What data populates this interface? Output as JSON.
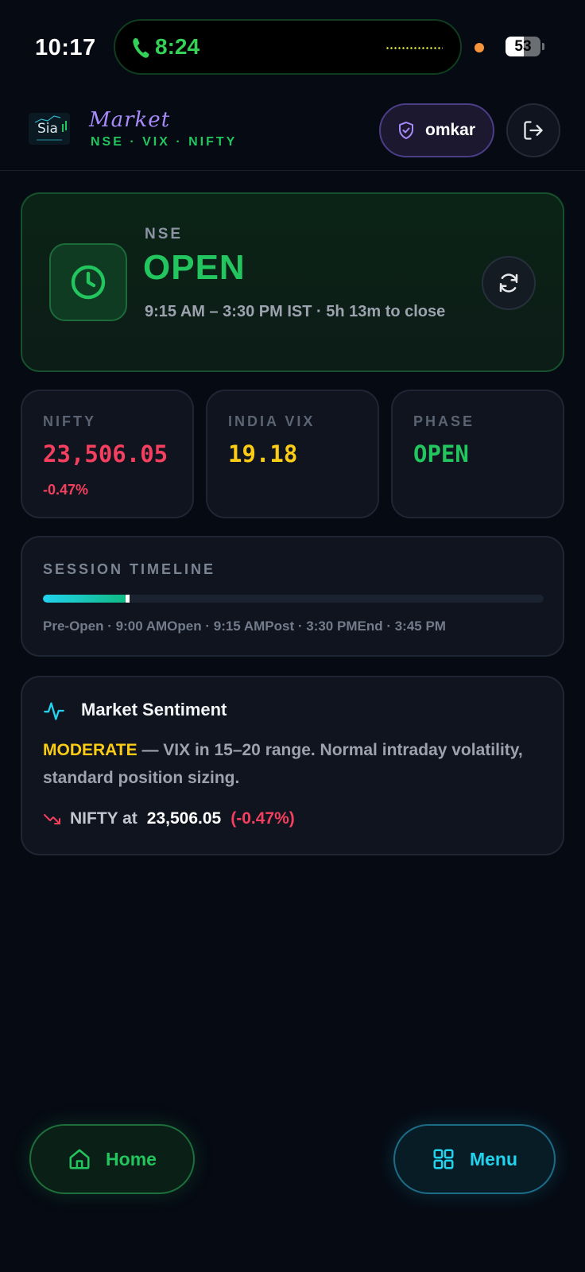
{
  "status_bar": {
    "time": "10:17",
    "call_time": "8:24",
    "battery": "53",
    "battery_level": 0.53
  },
  "header": {
    "logo_text": "Sia",
    "brand_title": "Market",
    "brand_subtitle": "NSE · VIX · NIFTY",
    "user_name": "omkar"
  },
  "market_status": {
    "exchange": "NSE",
    "status": "OPEN",
    "hours": "9:15 AM – 3:30 PM IST · 5h 13m to close"
  },
  "stats": {
    "nifty": {
      "label": "NIFTY",
      "value": "23,506.05",
      "change": "-0.47%"
    },
    "vix": {
      "label": "INDIA VIX",
      "value": "19.18"
    },
    "phase": {
      "label": "PHASE",
      "value": "OPEN"
    }
  },
  "timeline": {
    "title": "SESSION TIMELINE",
    "progress": 0.17,
    "labels": "Pre-Open · 9:00 AMOpen · 9:15 AMPost · 3:30 PMEnd · 3:45 PM"
  },
  "sentiment": {
    "title": "Market Sentiment",
    "level": "MODERATE",
    "description": " — VIX in 15–20 range. Normal intraday volatility, standard position sizing.",
    "nifty_label": "NIFTY at",
    "nifty_value": "23,506.05",
    "nifty_change": "(-0.47%)"
  },
  "nav": {
    "home_label": "Home",
    "menu_label": "Menu"
  },
  "colors": {
    "background": "#060a13",
    "positive": "#22c55e",
    "negative": "#f43f5e",
    "vix": "#facc15",
    "accent_cyan": "#22d3ee",
    "accent_purple": "#a78bfa"
  },
  "icons": {
    "call": "phone-icon",
    "user_badge": "shield-check-icon",
    "logout": "logout-icon",
    "market_clock": "clock-icon",
    "refresh": "refresh-icon",
    "sentiment": "activity-icon",
    "trend": "trending-down-icon",
    "home": "home-icon",
    "menu": "grid-icon"
  }
}
